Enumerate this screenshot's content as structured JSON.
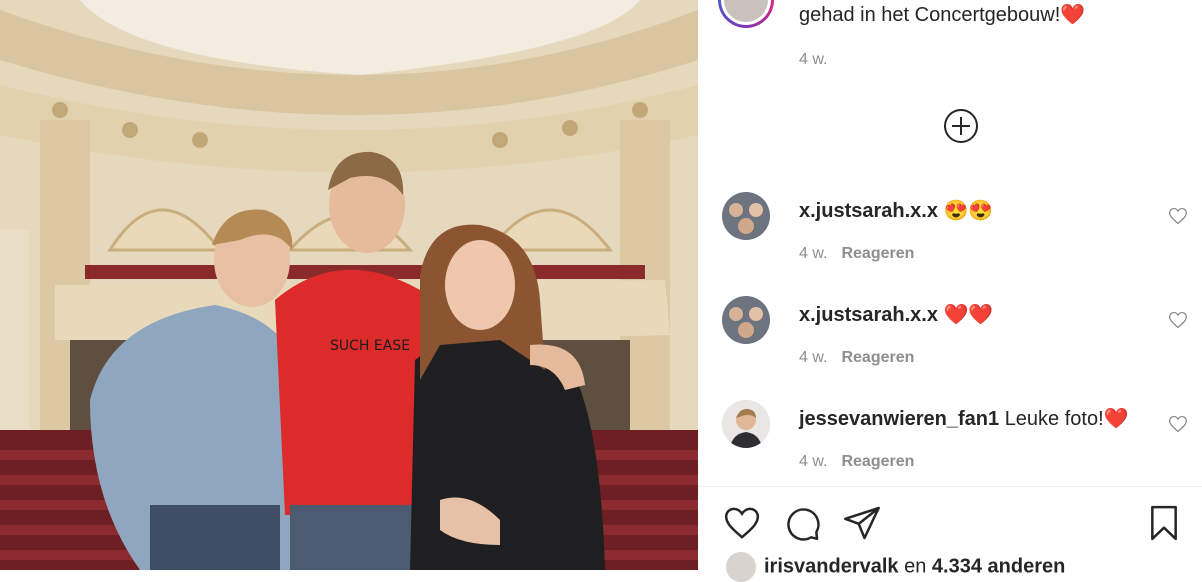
{
  "caption": {
    "text": "gehad in het Concertgebouw!",
    "emoji": "❤️",
    "time": "4 w."
  },
  "load_more_icon": "plus-circle-icon",
  "comments": [
    {
      "username": "x.justsarah.x.x",
      "text": "😍😍",
      "time": "4 w.",
      "reply": "Reageren"
    },
    {
      "username": "x.justsarah.x.x",
      "text": "❤️❤️",
      "time": "4 w.",
      "reply": "Reageren"
    },
    {
      "username": "jessevanwieren_fan1",
      "text": "Leuke foto!❤️",
      "time": "4 w.",
      "reply": "Reageren"
    }
  ],
  "actions": [
    "heart-icon",
    "comment-icon",
    "share-icon",
    "bookmark-icon"
  ],
  "likes": {
    "username": "irisvandervalk",
    "connector": "en",
    "count": "4.334 anderen"
  },
  "colors": {
    "heart": "#ed4956",
    "text": "#262626",
    "muted": "#8e8e8e"
  }
}
